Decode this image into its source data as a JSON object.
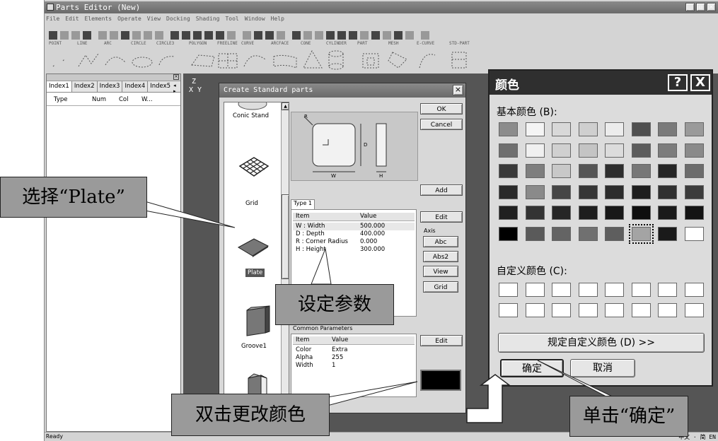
{
  "app": {
    "title": "Parts Editor (New)",
    "menus": [
      "File",
      "Edit",
      "Elements",
      "Operate",
      "View",
      "Docking",
      "Shading",
      "Tool",
      "Window",
      "Help"
    ],
    "palette_labels": [
      "POINT",
      "LINE",
      "ARC",
      "CIRCLE",
      "CIRCLE3",
      "POLYGON",
      "FREELINE",
      "CURVE",
      "ARCFACE",
      "CONE",
      "CYLINDER",
      "PART",
      "MESH",
      "E-CURVE",
      "STD-PART"
    ],
    "view_axis_z": "Z",
    "view_axis_xy": "X Y",
    "status": "Ready",
    "status_right": "中文 · 简 EN"
  },
  "left_panel": {
    "tabs": [
      "Index1",
      "Index2",
      "Index3",
      "Index4",
      "Index5"
    ],
    "columns": [
      "Type",
      "Num",
      "Col",
      "W..."
    ]
  },
  "std_dialog": {
    "title": "Create Standard parts",
    "parts": [
      "Conic Stand",
      "Grid",
      "Plate",
      "Groove1"
    ],
    "dim_labels": {
      "r": "R",
      "d": "D",
      "w": "W",
      "h": "H"
    },
    "buttons": {
      "ok": "OK",
      "cancel": "Cancel",
      "add": "Add",
      "edit": "Edit",
      "edit2": "Edit"
    },
    "axis_label": "Axis",
    "axis_buttons": [
      "Abc",
      "Abs2",
      "View",
      "Grid"
    ],
    "type_tab": "Type 1",
    "param_headers": {
      "item": "Item",
      "value": "Value"
    },
    "params": [
      {
        "item": "W : Width",
        "value": "500.000"
      },
      {
        "item": "D : Depth",
        "value": "400.000"
      },
      {
        "item": "R : Corner Radius",
        "value": "0.000"
      },
      {
        "item": "H : Height",
        "value": "300.000"
      }
    ],
    "common_label": "Common Parameters",
    "common_headers": {
      "item": "Item",
      "value": "Value"
    },
    "common": [
      {
        "item": "Color",
        "value": "Extra"
      },
      {
        "item": "Alpha",
        "value": "255"
      },
      {
        "item": "Width",
        "value": "1"
      }
    ]
  },
  "color_dialog": {
    "title": "颜色",
    "help": "?",
    "close": "X",
    "basic_label": "基本颜色 (B):",
    "custom_label": "自定义颜色 (C):",
    "define_button": "规定自定义颜色 (D) >>",
    "ok": "确定",
    "cancel": "取消",
    "swatches": [
      [
        "#8c8c8c",
        "#f4f4f4",
        "#d8d8d8",
        "#cfcfcf",
        "#ececec",
        "#4f4f4f",
        "#7a7a7a",
        "#9a9a9a"
      ],
      [
        "#6f6f6f",
        "#f0f0f0",
        "#d0d0d0",
        "#c4c4c4",
        "#dcdcdc",
        "#5c5c5c",
        "#7c7c7c",
        "#8a8a8a"
      ],
      [
        "#3a3a3a",
        "#7e7e7e",
        "#c8c8c8",
        "#555555",
        "#2e2e2e",
        "#777777",
        "#262626",
        "#6c6c6c"
      ],
      [
        "#2a2a2a",
        "#8a8a8a",
        "#464646",
        "#363636",
        "#2c2c2c",
        "#1e1e1e",
        "#303030",
        "#3c3c3c"
      ],
      [
        "#202020",
        "#333333",
        "#262626",
        "#1e1e1e",
        "#181818",
        "#0e0e0e",
        "#1a1a1a",
        "#141414"
      ],
      [
        "#000000",
        "#5a5a5a",
        "#646464",
        "#707070",
        "#5e5e5e",
        "#a4a4a4",
        "#1a1a1a",
        "#ffffff"
      ]
    ],
    "selected_index": [
      5,
      5
    ]
  },
  "callouts": {
    "select_plate": "选择“Plate”",
    "set_params": "设定参数",
    "dbl_color": "双击更改颜色",
    "click_ok": "单击“确定”"
  },
  "colors": {
    "workspace": "#555555",
    "extra_color_swatch": "#000000"
  }
}
